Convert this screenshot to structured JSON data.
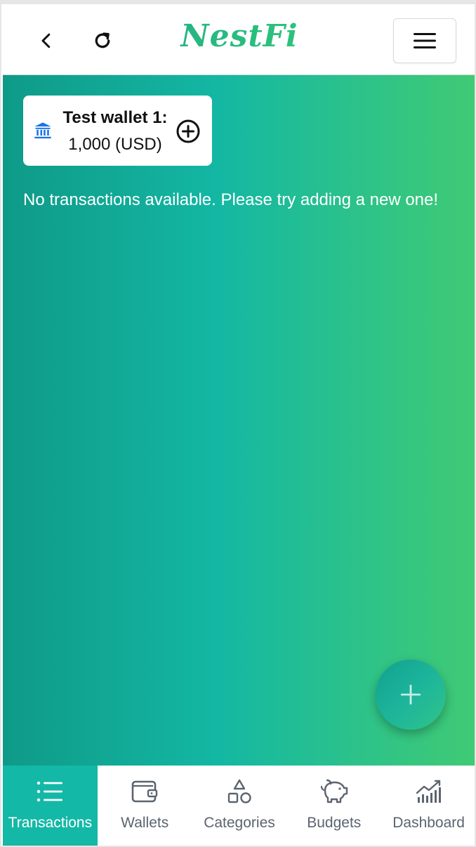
{
  "header": {
    "logo_text": "NestFi",
    "back_icon": "chevron-left-icon",
    "refresh_icon": "refresh-icon",
    "menu_icon": "hamburger-menu-icon"
  },
  "wallet_card": {
    "name": "Test wallet 1:",
    "balance": "1,000 (USD)",
    "icon": "bank-icon",
    "add_icon": "plus-circle-icon"
  },
  "main": {
    "empty_message": "No transactions available. Please try adding a new one!",
    "fab_icon": "plus-icon"
  },
  "bottom_nav": {
    "items": [
      {
        "label": "Transactions",
        "icon": "list-icon",
        "active": true
      },
      {
        "label": "Wallets",
        "icon": "wallet-icon",
        "active": false
      },
      {
        "label": "Categories",
        "icon": "shapes-icon",
        "active": false
      },
      {
        "label": "Budgets",
        "icon": "piggy-bank-icon",
        "active": false
      },
      {
        "label": "Dashboard",
        "icon": "chart-icon",
        "active": false
      }
    ]
  },
  "colors": {
    "accent": "#14b8a6",
    "gradient_start": "#0f9a88",
    "gradient_end": "#40ca74",
    "bank_icon": "#1a73e8",
    "nav_text": "#5b6470"
  }
}
